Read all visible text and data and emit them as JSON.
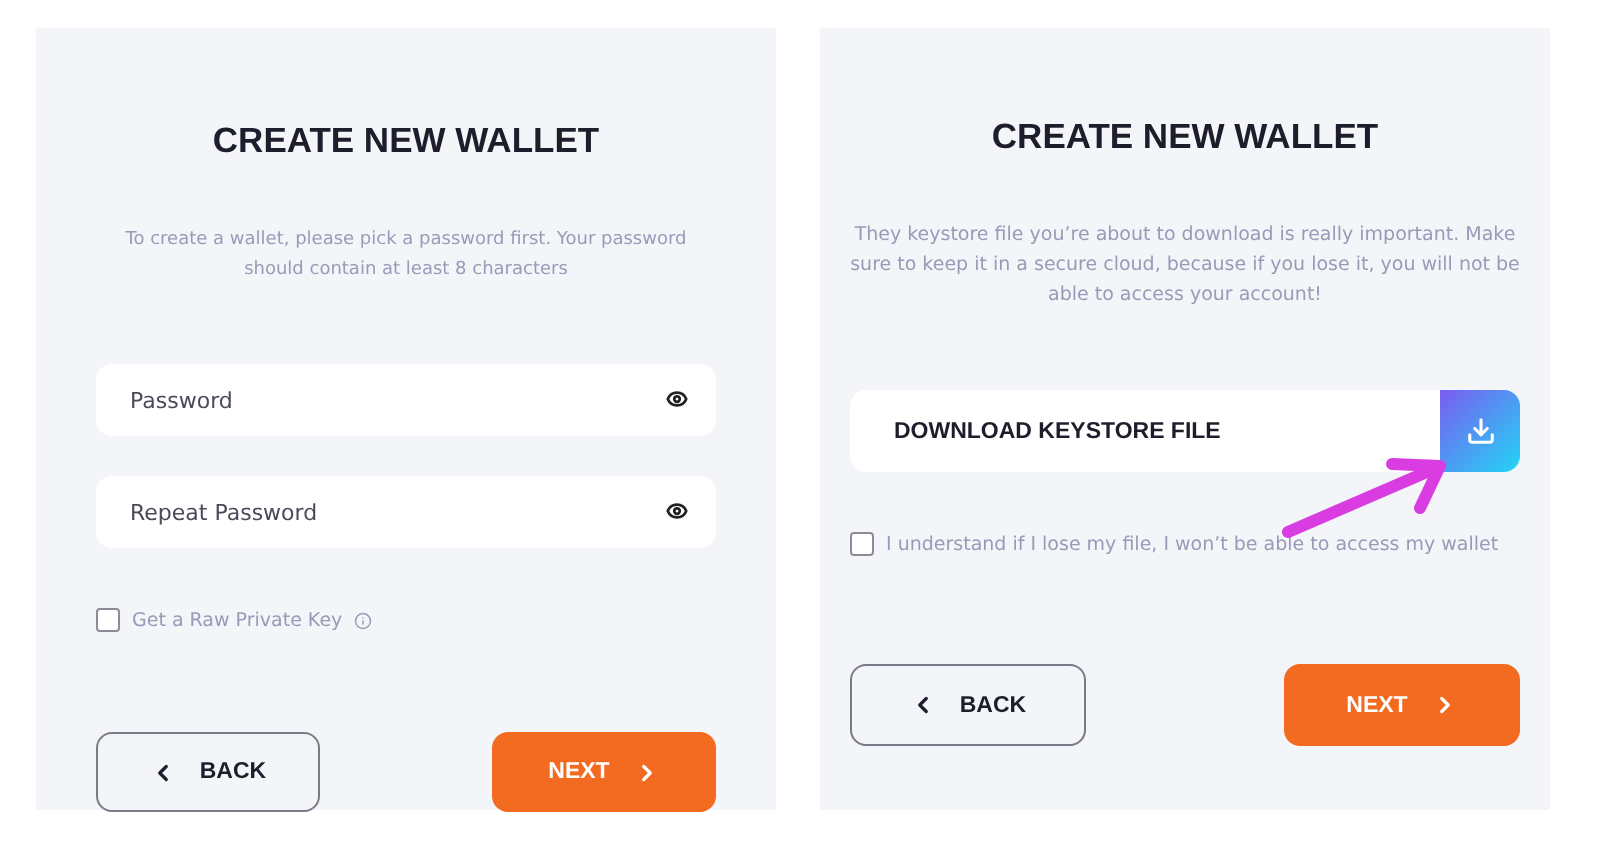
{
  "left_panel": {
    "title": "CREATE NEW WALLET",
    "description": "To create a wallet, please pick a password first. Your password should contain at least 8 characters",
    "fields": [
      {
        "placeholder": "Password"
      },
      {
        "placeholder": "Repeat Password"
      }
    ],
    "checkbox": {
      "label": "Get a Raw Private Key",
      "checked": false
    },
    "back_button": {
      "label": "BACK"
    },
    "next_button": {
      "label": "NEXT"
    }
  },
  "right_panel": {
    "title": "CREATE NEW WALLET",
    "description": "They keystore file you’re about to download is really important. Make sure to keep it in a secure cloud, because if you lose it, you will not be able to access your account!",
    "download": {
      "label": "DOWNLOAD KEYSTORE FILE"
    },
    "checkbox": {
      "label": "I understand if I lose my file, I won’t be able to access my wallet",
      "checked": false
    },
    "back_button": {
      "label": "BACK"
    },
    "next_button": {
      "label": "NEXT"
    }
  }
}
